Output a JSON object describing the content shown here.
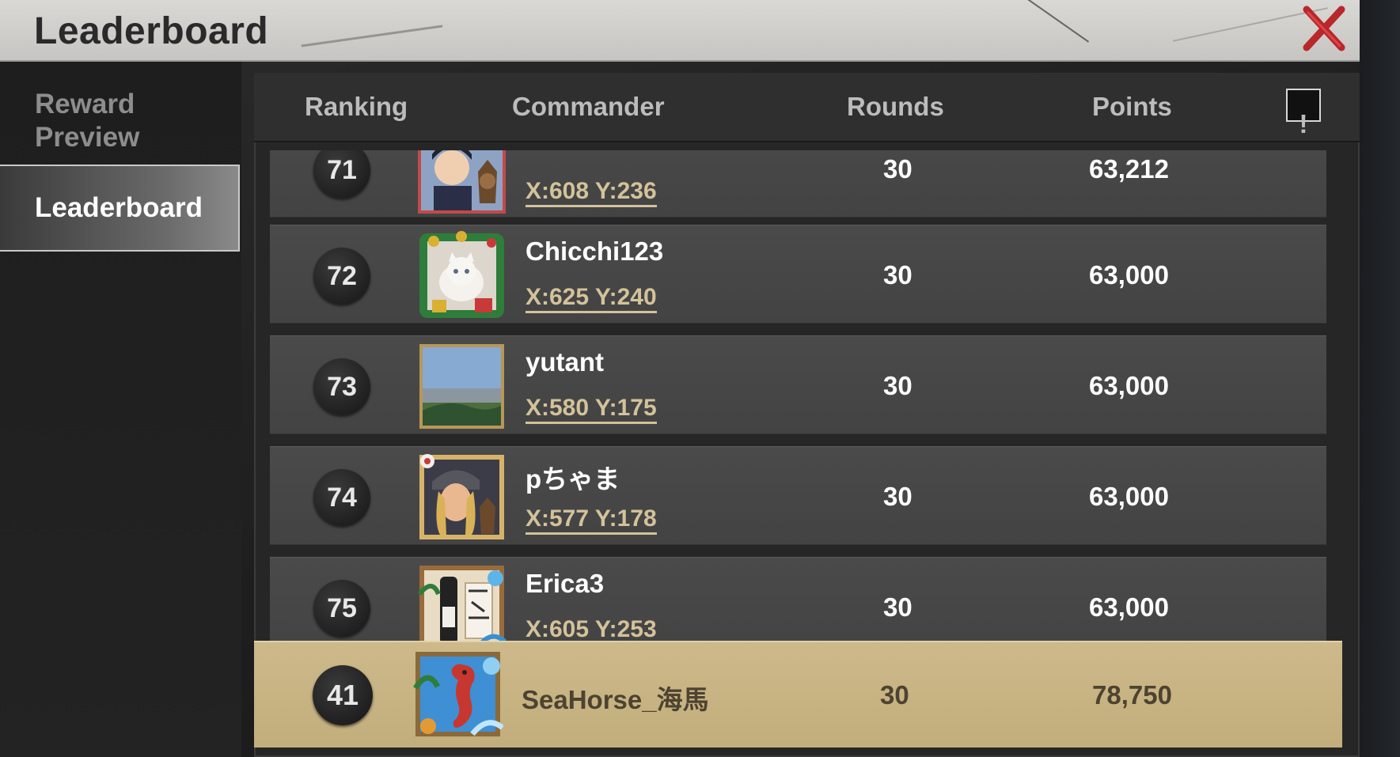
{
  "header": {
    "title": "Leaderboard"
  },
  "sidebar": {
    "items": [
      {
        "label": "Reward Preview"
      },
      {
        "label": "Leaderboard"
      }
    ]
  },
  "table": {
    "columns": [
      "Ranking",
      "Commander",
      "Rounds",
      "Points"
    ],
    "info_label": "!",
    "rows": [
      {
        "rank": "71",
        "name": "",
        "coords": "X:608 Y:236",
        "rounds": "30",
        "points": "63,212"
      },
      {
        "rank": "72",
        "name": "Chicchi123",
        "coords": "X:625 Y:240",
        "rounds": "30",
        "points": "63,000"
      },
      {
        "rank": "73",
        "name": "yutant",
        "coords": "X:580 Y:175",
        "rounds": "30",
        "points": "63,000"
      },
      {
        "rank": "74",
        "name": "pちゃま",
        "coords": "X:577 Y:178",
        "rounds": "30",
        "points": "63,000"
      },
      {
        "rank": "75",
        "name": "Erica3",
        "coords": "X:605 Y:253",
        "rounds": "30",
        "points": "63,000"
      }
    ],
    "self": {
      "rank": "41",
      "name": "SeaHorse_海馬",
      "rounds": "30",
      "points": "78,750"
    }
  },
  "colors": {
    "accent_gold": "#c2ad7c",
    "coords_text": "#d3c29a",
    "close_red": "#b8272a"
  },
  "icons": {
    "close": "close-x-icon",
    "info": "info-exclamation-icon",
    "avatars": [
      "avatar-man-with-dog",
      "avatar-kitten-christmas-wreath",
      "avatar-city-landscape",
      "avatar-woman-with-dog",
      "avatar-sake-bottle",
      "avatar-seahorse"
    ]
  }
}
